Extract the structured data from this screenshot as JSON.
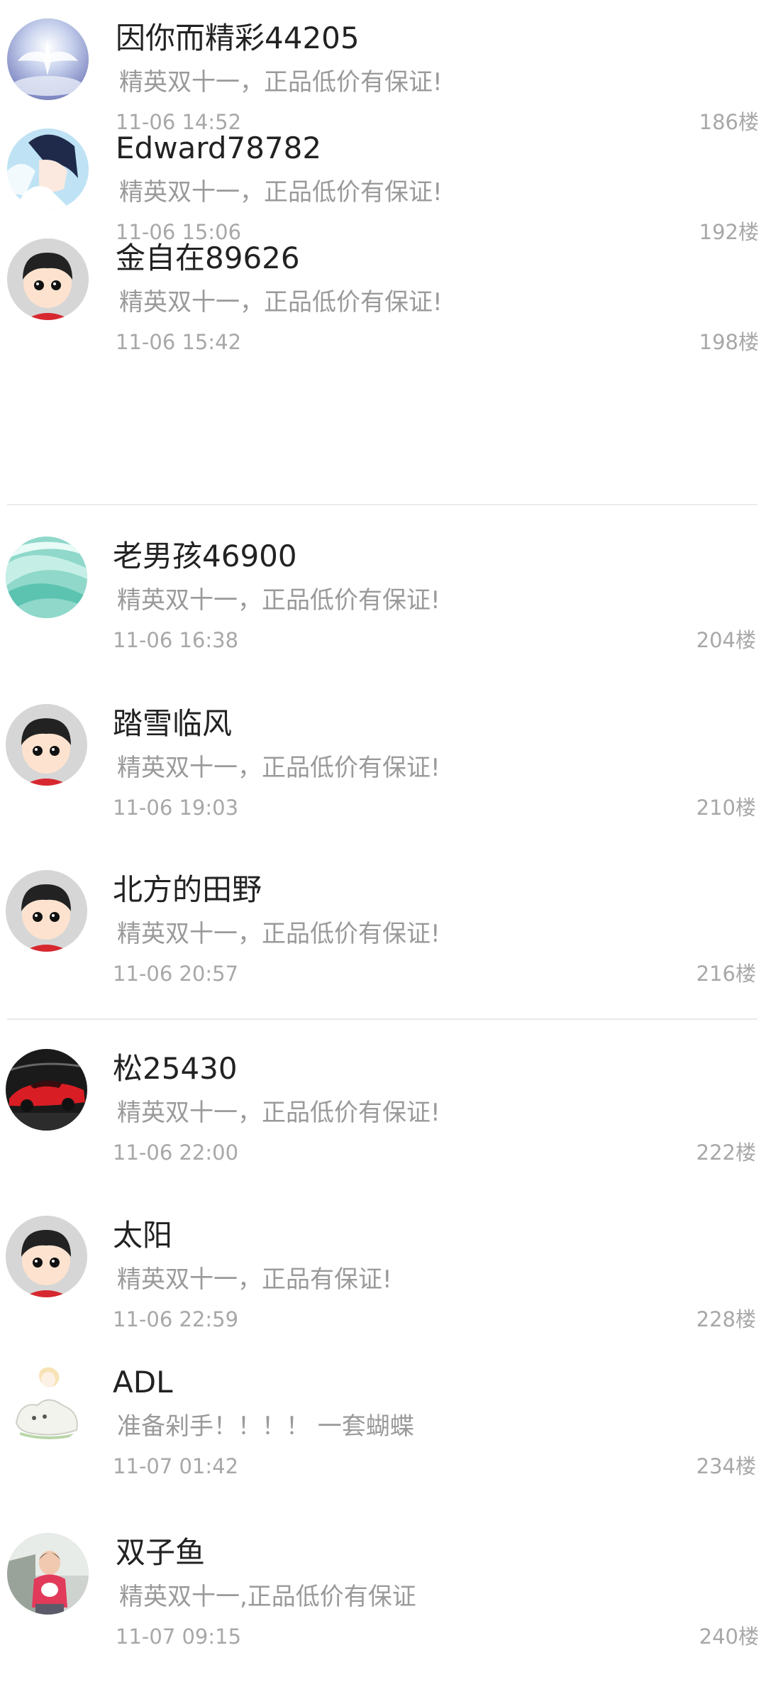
{
  "posts": [
    {
      "name": "因你而精彩44205",
      "content": "精英双十一，正品低价有保证!",
      "time": "11-06 14:52",
      "floor": "186楼",
      "avatar": "sky-wings-avatar"
    },
    {
      "name": "Edward78782",
      "content": "精英双十一，正品低价有保证!",
      "time": "11-06 15:06",
      "floor": "192楼",
      "avatar": "anime-boy-avatar"
    },
    {
      "name": "金自在89626",
      "content": "精英双十一，正品低价有保证!",
      "time": "11-06 15:42",
      "floor": "198楼",
      "avatar": "default-cartoon-avatar"
    },
    {
      "name": "老男孩46900",
      "content": "精英双十一，正品低价有保证!",
      "time": "11-06 16:38",
      "floor": "204楼",
      "avatar": "mint-silk-avatar"
    },
    {
      "name": "踏雪临风",
      "content": "精英双十一，正品低价有保证!",
      "time": "11-06 19:03",
      "floor": "210楼",
      "avatar": "default-cartoon-avatar"
    },
    {
      "name": "北方的田野",
      "content": "精英双十一，正品低价有保证!",
      "time": "11-06 20:57",
      "floor": "216楼",
      "avatar": "default-cartoon-avatar"
    },
    {
      "name": "松25430",
      "content": "精英双十一，正品低价有保证!",
      "time": "11-06 22:00",
      "floor": "222楼",
      "avatar": "red-sports-car-avatar"
    },
    {
      "name": "太阳",
      "content": "精英双十一，正品有保证!",
      "time": "11-06 22:59",
      "floor": "228楼",
      "avatar": "default-cartoon-avatar"
    },
    {
      "name": "ADL",
      "content": "准备剁手！！！！ 一套蝴蝶",
      "time": "11-07 01:42",
      "floor": "234楼",
      "avatar": "sketch-boy-dog-avatar"
    },
    {
      "name": "双子鱼",
      "content": "精英双十一,正品低价有保证",
      "time": "11-07 09:15",
      "floor": "240楼",
      "avatar": "child-photo-avatar"
    }
  ],
  "colors": {
    "name": "#222222",
    "content": "#9a9a9a",
    "meta": "#a8a8a8",
    "divider": "#eaeaea"
  }
}
